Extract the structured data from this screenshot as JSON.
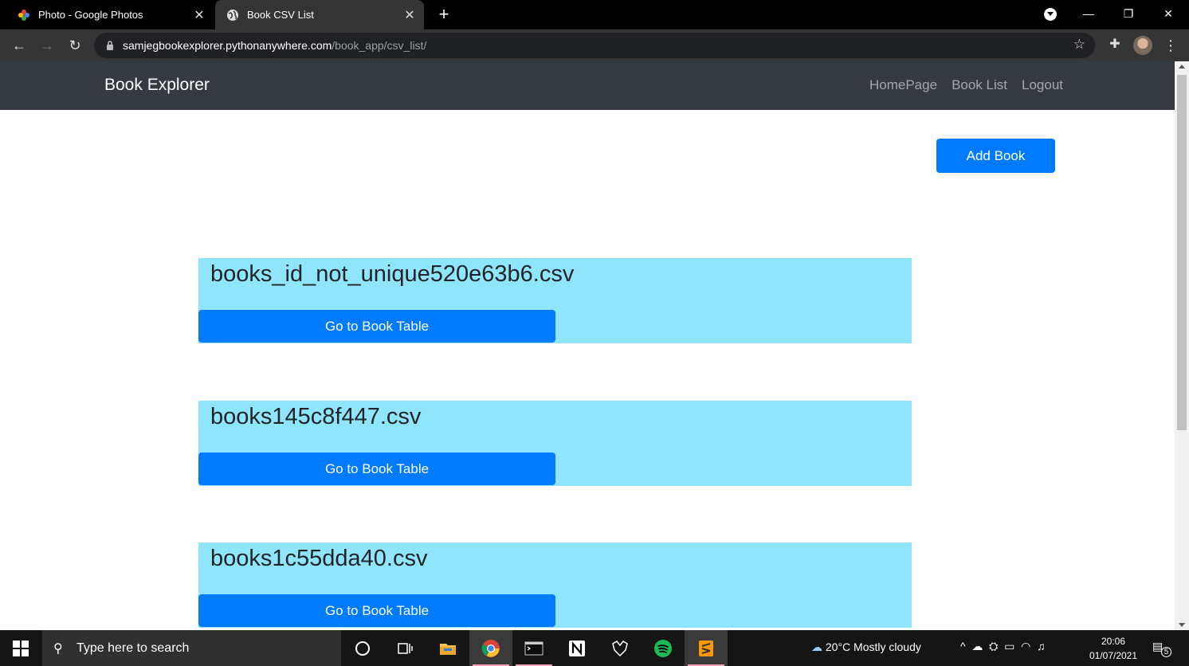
{
  "browser": {
    "tabs": [
      {
        "title": "Photo - Google Photos",
        "active": false
      },
      {
        "title": "Book CSV List",
        "active": true
      }
    ],
    "url_host": "samjegbookexplorer.pythonanywhere.com",
    "url_path": "/book_app/csv_list/"
  },
  "navbar": {
    "brand": "Book Explorer",
    "links": [
      "HomePage",
      "Book List",
      "Logout"
    ]
  },
  "actions": {
    "add_book": "Add Book"
  },
  "csv_files": [
    {
      "name": "books_id_not_unique520e63b6.csv",
      "button": "Go to Book Table"
    },
    {
      "name": "books145c8f447.csv",
      "button": "Go to Book Table"
    },
    {
      "name": "books1c55dda40.csv",
      "button": "Go to Book Table"
    }
  ],
  "taskbar": {
    "search_placeholder": "Type here to search",
    "weather": "20°C  Mostly cloudy",
    "time": "20:06",
    "date": "01/07/2021",
    "notification_count": "5"
  },
  "colors": {
    "navbar": "#343a40",
    "primary": "#007bff",
    "card_bg": "#8fe6fc"
  }
}
